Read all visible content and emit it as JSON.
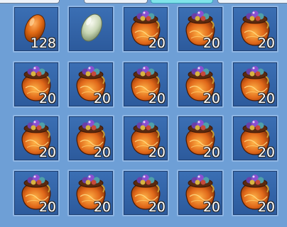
{
  "tabs": [
    "",
    "",
    "",
    ""
  ],
  "inventory": {
    "rows": [
      [
        {
          "item": "orange-egg-icon",
          "qty": "128"
        },
        {
          "item": "pale-green-egg-icon",
          "qty": ""
        },
        {
          "item": "treasure-pouch-icon",
          "qty": "20"
        },
        {
          "item": "treasure-pouch-icon",
          "qty": "20"
        },
        {
          "item": "treasure-pouch-icon",
          "qty": "20"
        }
      ],
      [
        {
          "item": "treasure-pouch-icon",
          "qty": "20"
        },
        {
          "item": "treasure-pouch-icon",
          "qty": "20"
        },
        {
          "item": "treasure-pouch-icon",
          "qty": "20"
        },
        {
          "item": "treasure-pouch-icon",
          "qty": "20"
        },
        {
          "item": "treasure-pouch-icon",
          "qty": "20"
        }
      ],
      [
        {
          "item": "treasure-pouch-icon",
          "qty": "20"
        },
        {
          "item": "treasure-pouch-icon",
          "qty": "20"
        },
        {
          "item": "treasure-pouch-icon",
          "qty": "20"
        },
        {
          "item": "treasure-pouch-icon",
          "qty": "20"
        },
        {
          "item": "treasure-pouch-icon",
          "qty": "20"
        }
      ],
      [
        {
          "item": "treasure-pouch-icon",
          "qty": "20"
        },
        {
          "item": "treasure-pouch-icon",
          "qty": "20"
        },
        {
          "item": "treasure-pouch-icon",
          "qty": "20"
        },
        {
          "item": "treasure-pouch-icon",
          "qty": "20"
        },
        {
          "item": "treasure-pouch-icon",
          "qty": "20"
        }
      ]
    ]
  },
  "colors": {
    "slot_bg": "#3b6fb4",
    "slot_border": "#8fb6e4",
    "panel_bg": "#6e9fd6",
    "active_tab": "#7fe4ea"
  }
}
